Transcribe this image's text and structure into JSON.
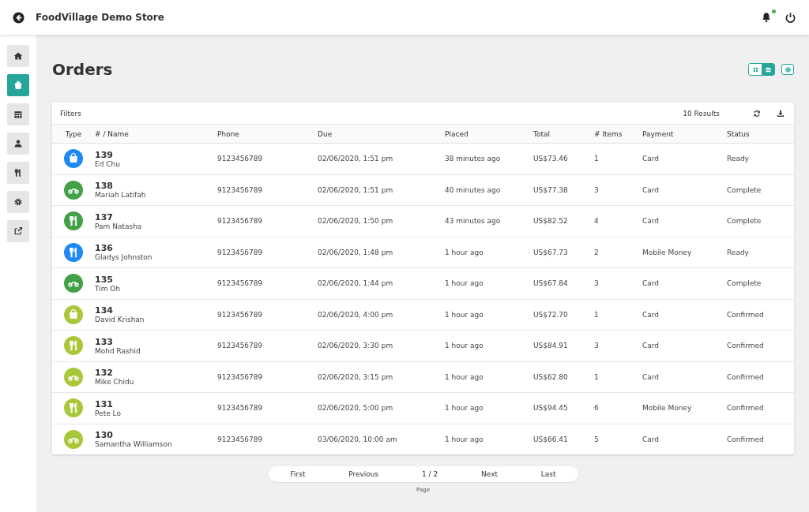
{
  "header": {
    "title": "FoodVillage Demo Store",
    "notification_dot": true
  },
  "sidebar": {
    "items": [
      {
        "kind": "home",
        "selected": false
      },
      {
        "kind": "bag",
        "selected": true
      },
      {
        "kind": "calendar",
        "selected": false
      },
      {
        "kind": "user",
        "selected": false
      },
      {
        "kind": "cutlery",
        "selected": false
      },
      {
        "kind": "gear",
        "selected": false
      },
      {
        "kind": "external",
        "selected": false
      }
    ]
  },
  "page": {
    "title": "Orders",
    "views": [
      {
        "kind": "grid",
        "selected": false
      },
      {
        "kind": "list",
        "selected": true
      }
    ]
  },
  "table": {
    "filters": "Filters",
    "results": "10 Results",
    "columns": [
      "Type",
      "# / Name",
      "Phone",
      "Due",
      "Placed",
      "Total",
      "# Items",
      "Payment",
      "Status"
    ],
    "rows": [
      {
        "kind": "bag",
        "color": "#1e88f5",
        "number": "139",
        "name": "Ed Chu",
        "phone": "9123456789",
        "due": "02/06/2020, 1:51 pm",
        "placed": "38 minutes ago",
        "total": "US$73.46",
        "items": "1",
        "payment": "Card",
        "status": "Ready"
      },
      {
        "kind": "bike",
        "color": "#43a047",
        "number": "138",
        "name": "Mariah Latifah",
        "phone": "9123456789",
        "due": "02/06/2020, 1:51 pm",
        "placed": "40 minutes ago",
        "total": "US$77.38",
        "items": "3",
        "payment": "Card",
        "status": "Complete"
      },
      {
        "kind": "cutlery",
        "color": "#43a047",
        "number": "137",
        "name": "Pam Natasha",
        "phone": "9123456789",
        "due": "02/06/2020, 1:50 pm",
        "placed": "43 minutes ago",
        "total": "US$82.52",
        "items": "4",
        "payment": "Card",
        "status": "Complete"
      },
      {
        "kind": "cutlery",
        "color": "#1e88f5",
        "number": "136",
        "name": "Gladys Johnston",
        "phone": "9123456789",
        "due": "02/06/2020, 1:48 pm",
        "placed": "1 hour ago",
        "total": "US$67.73",
        "items": "2",
        "payment": "Mobile Money",
        "status": "Ready"
      },
      {
        "kind": "bike",
        "color": "#43a047",
        "number": "135",
        "name": "Tim Oh",
        "phone": "9123456789",
        "due": "02/06/2020, 1:44 pm",
        "placed": "1 hour ago",
        "total": "US$67.84",
        "items": "3",
        "payment": "Card",
        "status": "Complete"
      },
      {
        "kind": "bag",
        "color": "#a8c83a",
        "number": "134",
        "name": "David Krishan",
        "phone": "9123456789",
        "due": "02/06/2020, 4:00 pm",
        "placed": "1 hour ago",
        "total": "US$72.70",
        "items": "1",
        "payment": "Card",
        "status": "Confirmed"
      },
      {
        "kind": "cutlery",
        "color": "#a8c83a",
        "number": "133",
        "name": "Mohd Rashid",
        "phone": "9123456789",
        "due": "02/06/2020, 3:30 pm",
        "placed": "1 hour ago",
        "total": "US$84.91",
        "items": "3",
        "payment": "Card",
        "status": "Confirmed"
      },
      {
        "kind": "bike",
        "color": "#a8c83a",
        "number": "132",
        "name": "Mike Chidu",
        "phone": "9123456789",
        "due": "02/06/2020, 3:15 pm",
        "placed": "1 hour ago",
        "total": "US$62.80",
        "items": "1",
        "payment": "Card",
        "status": "Confirmed"
      },
      {
        "kind": "cutlery",
        "color": "#a8c83a",
        "number": "131",
        "name": "Pete Lo",
        "phone": "9123456789",
        "due": "02/06/2020, 5:00 pm",
        "placed": "1 hour ago",
        "total": "US$94.45",
        "items": "6",
        "payment": "Mobile Money",
        "status": "Confirmed"
      },
      {
        "kind": "bike",
        "color": "#a8c83a",
        "number": "130",
        "name": "Samantha Williamson",
        "phone": "9123456789",
        "due": "03/06/2020, 10:00 am",
        "placed": "1 hour ago",
        "total": "US$66.41",
        "items": "5",
        "payment": "Card",
        "status": "Confirmed"
      }
    ]
  },
  "pagination": {
    "first": "First",
    "previous": "Previous",
    "current": "1 / 2",
    "next": "Next",
    "last": "Last",
    "caption": "Page"
  }
}
